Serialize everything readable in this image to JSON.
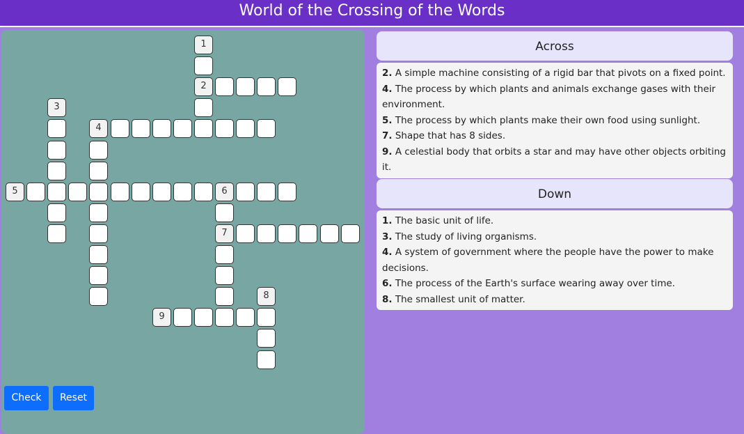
{
  "title": "World of the Crossing of the Words",
  "buttons": {
    "check": "Check",
    "reset": "Reset"
  },
  "across": {
    "heading": "Across",
    "clues": [
      {
        "num": "2.",
        "text": "A simple machine consisting of a rigid bar that pivots on a fixed point."
      },
      {
        "num": "4.",
        "text": "The process by which plants and animals exchange gases with their environment."
      },
      {
        "num": "5.",
        "text": "The process by which plants make their own food using sunlight."
      },
      {
        "num": "7.",
        "text": "Shape that has 8 sides."
      },
      {
        "num": "9.",
        "text": "A celestial body that orbits a star and may have other objects orbiting it."
      }
    ]
  },
  "down": {
    "heading": "Down",
    "clues": [
      {
        "num": "1.",
        "text": "The basic unit of life."
      },
      {
        "num": "3.",
        "text": "The study of living organisms."
      },
      {
        "num": "4.",
        "text": "A system of government where the people have the power to make decisions."
      },
      {
        "num": "6.",
        "text": "The process of the Earth's surface wearing away over time."
      },
      {
        "num": "8.",
        "text": "The smallest unit of matter."
      }
    ]
  },
  "grid": {
    "cells": [
      {
        "r": 0,
        "c": 9,
        "n": "1"
      },
      {
        "r": 1,
        "c": 9
      },
      {
        "r": 2,
        "c": 9,
        "n": "2"
      },
      {
        "r": 2,
        "c": 10
      },
      {
        "r": 2,
        "c": 11
      },
      {
        "r": 2,
        "c": 12
      },
      {
        "r": 2,
        "c": 13
      },
      {
        "r": 3,
        "c": 2,
        "n": "3"
      },
      {
        "r": 3,
        "c": 9
      },
      {
        "r": 4,
        "c": 2
      },
      {
        "r": 4,
        "c": 4,
        "n": "4"
      },
      {
        "r": 4,
        "c": 5
      },
      {
        "r": 4,
        "c": 6
      },
      {
        "r": 4,
        "c": 7
      },
      {
        "r": 4,
        "c": 8
      },
      {
        "r": 4,
        "c": 9
      },
      {
        "r": 4,
        "c": 10
      },
      {
        "r": 4,
        "c": 11
      },
      {
        "r": 4,
        "c": 12
      },
      {
        "r": 5,
        "c": 2
      },
      {
        "r": 5,
        "c": 4
      },
      {
        "r": 6,
        "c": 2
      },
      {
        "r": 6,
        "c": 4
      },
      {
        "r": 7,
        "c": 0,
        "n": "5"
      },
      {
        "r": 7,
        "c": 1
      },
      {
        "r": 7,
        "c": 2
      },
      {
        "r": 7,
        "c": 3
      },
      {
        "r": 7,
        "c": 4
      },
      {
        "r": 7,
        "c": 5
      },
      {
        "r": 7,
        "c": 6
      },
      {
        "r": 7,
        "c": 7
      },
      {
        "r": 7,
        "c": 8
      },
      {
        "r": 7,
        "c": 9
      },
      {
        "r": 7,
        "c": 10,
        "n": "6"
      },
      {
        "r": 7,
        "c": 11
      },
      {
        "r": 7,
        "c": 12
      },
      {
        "r": 7,
        "c": 13
      },
      {
        "r": 8,
        "c": 2
      },
      {
        "r": 8,
        "c": 4
      },
      {
        "r": 8,
        "c": 10
      },
      {
        "r": 9,
        "c": 2
      },
      {
        "r": 9,
        "c": 4
      },
      {
        "r": 9,
        "c": 10,
        "n": "7"
      },
      {
        "r": 9,
        "c": 11
      },
      {
        "r": 9,
        "c": 12
      },
      {
        "r": 9,
        "c": 13
      },
      {
        "r": 9,
        "c": 14
      },
      {
        "r": 9,
        "c": 15
      },
      {
        "r": 9,
        "c": 16
      },
      {
        "r": 10,
        "c": 4
      },
      {
        "r": 10,
        "c": 10
      },
      {
        "r": 11,
        "c": 4
      },
      {
        "r": 11,
        "c": 10
      },
      {
        "r": 12,
        "c": 4
      },
      {
        "r": 12,
        "c": 10
      },
      {
        "r": 12,
        "c": 12,
        "n": "8"
      },
      {
        "r": 13,
        "c": 7,
        "n": "9"
      },
      {
        "r": 13,
        "c": 8
      },
      {
        "r": 13,
        "c": 9
      },
      {
        "r": 13,
        "c": 10
      },
      {
        "r": 13,
        "c": 11
      },
      {
        "r": 13,
        "c": 12
      },
      {
        "r": 14,
        "c": 12
      },
      {
        "r": 15,
        "c": 12
      }
    ]
  }
}
